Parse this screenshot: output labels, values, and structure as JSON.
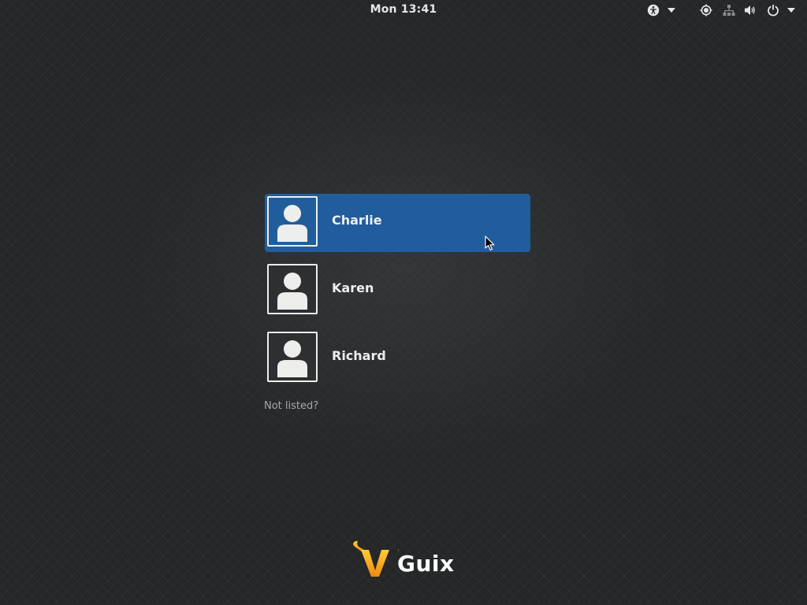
{
  "topbar": {
    "clock": "Mon 13:41",
    "indicators": [
      {
        "icon": "accessibility-icon"
      },
      {
        "icon": "chevron-down-icon"
      },
      {
        "icon": "brightness-icon"
      },
      {
        "icon": "network-icon"
      },
      {
        "icon": "volume-icon"
      },
      {
        "icon": "power-icon"
      },
      {
        "icon": "chevron-down-icon"
      }
    ]
  },
  "users": [
    {
      "name": "Charlie",
      "selected": true,
      "icon": "user-avatar-icon"
    },
    {
      "name": "Karen",
      "selected": false,
      "icon": "user-avatar-icon"
    },
    {
      "name": "Richard",
      "selected": false,
      "icon": "user-avatar-icon"
    }
  ],
  "not_listed_label": "Not listed?",
  "logo": {
    "text": "Guix",
    "icon": "guix-logo-icon"
  },
  "colors": {
    "selection": "#215d9c",
    "background": "#242627",
    "text": "#eeeeec",
    "muted_text": "#a8a8a6",
    "logo_orange": "#f5a623"
  }
}
